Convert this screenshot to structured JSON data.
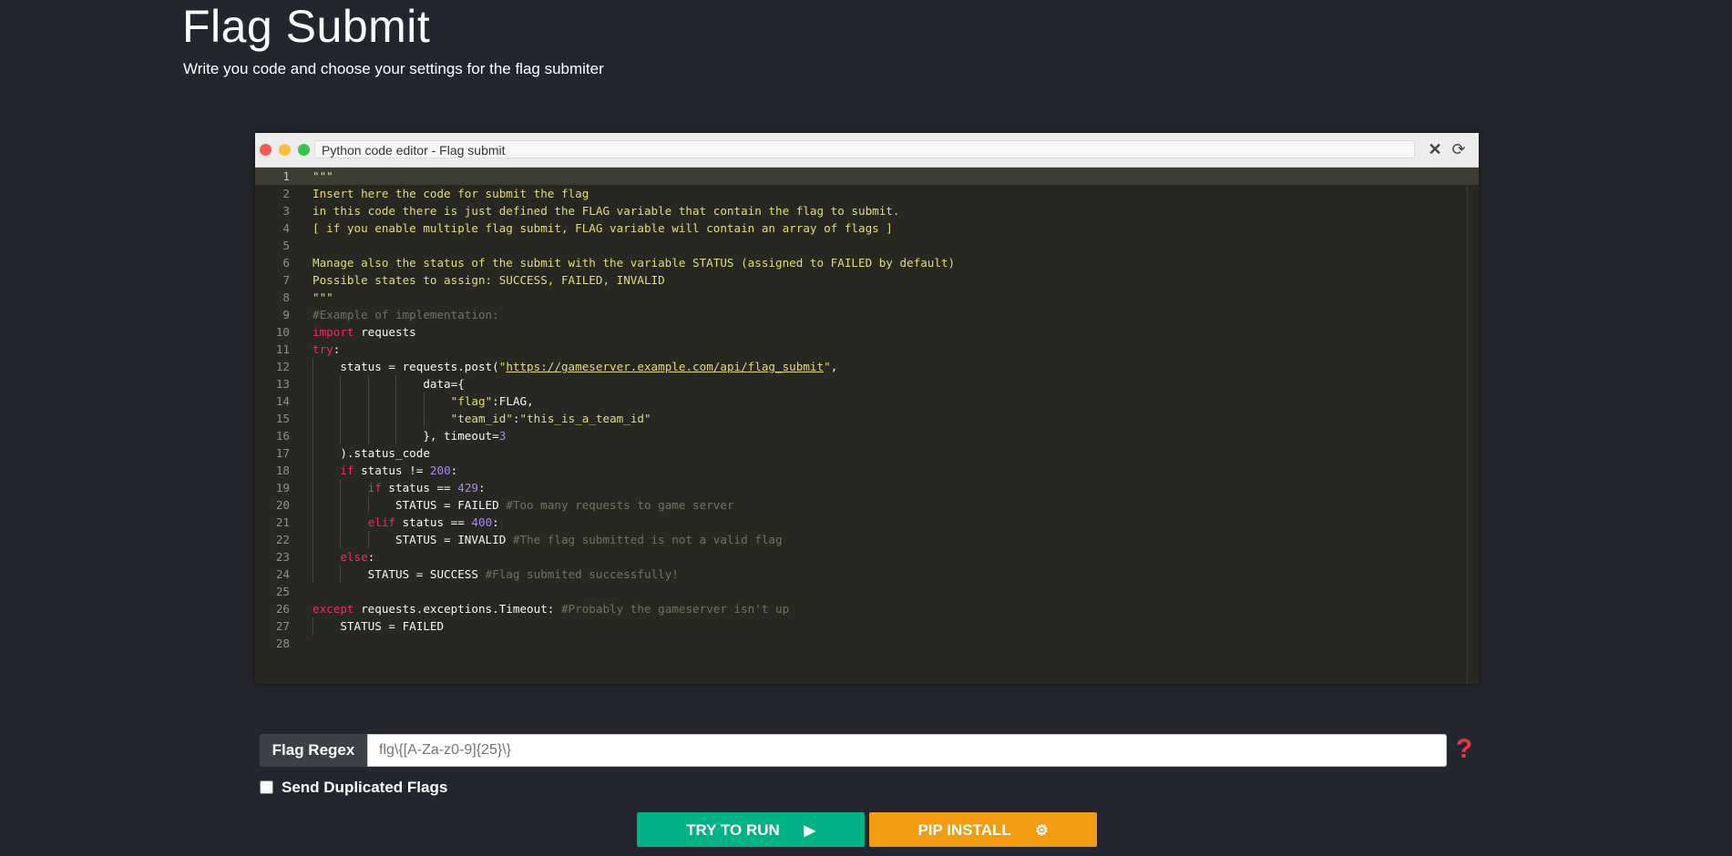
{
  "header": {
    "title": "Flag Submit",
    "subtitle": "Write you code and choose your settings for the flag submiter"
  },
  "editor": {
    "title": "Python code editor - Flag submit",
    "active_line": 1,
    "lines": [
      [
        {
          "t": "\"\"\"",
          "c": "str"
        }
      ],
      [
        {
          "t": "Insert here the code for submit the flag",
          "c": "str"
        }
      ],
      [
        {
          "t": "in this code there is just defined the FLAG variable that contain the flag to submit.",
          "c": "str"
        }
      ],
      [
        {
          "t": "[ if you enable multiple flag submit, FLAG variable will contain an array of flags ]",
          "c": "str"
        }
      ],
      [],
      [
        {
          "t": "Manage also the status of the submit with the variable STATUS (assigned to FAILED by default)",
          "c": "str"
        }
      ],
      [
        {
          "t": "Possible states to assign: SUCCESS, FAILED, INVALID",
          "c": "str"
        }
      ],
      [
        {
          "t": "\"\"\"",
          "c": "str"
        }
      ],
      [
        {
          "t": "#Example of implementation:",
          "c": "cm"
        }
      ],
      [
        {
          "t": "import",
          "c": "kw"
        },
        {
          "t": " requests",
          "c": ""
        }
      ],
      [
        {
          "t": "try",
          "c": "kw"
        },
        {
          "t": ":",
          "c": ""
        }
      ],
      [
        {
          "t": "    status = requests.post(",
          "c": ""
        },
        {
          "t": "\"",
          "c": "str"
        },
        {
          "t": "https://gameserver.example.com/api/flag_submit",
          "c": "url"
        },
        {
          "t": "\"",
          "c": "str"
        },
        {
          "t": ",",
          "c": ""
        }
      ],
      [
        {
          "t": "                data={",
          "c": ""
        }
      ],
      [
        {
          "t": "                    ",
          "c": ""
        },
        {
          "t": "\"flag\"",
          "c": "str"
        },
        {
          "t": ":FLAG,",
          "c": ""
        }
      ],
      [
        {
          "t": "                    ",
          "c": ""
        },
        {
          "t": "\"team_id\"",
          "c": "str"
        },
        {
          "t": ":",
          "c": ""
        },
        {
          "t": "\"this_is_a_team_id\"",
          "c": "str"
        }
      ],
      [
        {
          "t": "                }, timeout=",
          "c": ""
        },
        {
          "t": "3",
          "c": "num"
        }
      ],
      [
        {
          "t": "    ).status_code",
          "c": ""
        }
      ],
      [
        {
          "t": "    ",
          "c": ""
        },
        {
          "t": "if",
          "c": "kw"
        },
        {
          "t": " status != ",
          "c": ""
        },
        {
          "t": "200",
          "c": "num"
        },
        {
          "t": ":",
          "c": ""
        }
      ],
      [
        {
          "t": "        ",
          "c": ""
        },
        {
          "t": "if",
          "c": "kw"
        },
        {
          "t": " status == ",
          "c": ""
        },
        {
          "t": "429",
          "c": "num"
        },
        {
          "t": ":",
          "c": ""
        }
      ],
      [
        {
          "t": "            STATUS = FAILED ",
          "c": ""
        },
        {
          "t": "#Too many requests to game server",
          "c": "cm"
        }
      ],
      [
        {
          "t": "        ",
          "c": ""
        },
        {
          "t": "elif",
          "c": "kw"
        },
        {
          "t": " status == ",
          "c": ""
        },
        {
          "t": "400",
          "c": "num"
        },
        {
          "t": ":",
          "c": ""
        }
      ],
      [
        {
          "t": "            STATUS = INVALID ",
          "c": ""
        },
        {
          "t": "#The flag submitted is not a valid flag",
          "c": "cm"
        }
      ],
      [
        {
          "t": "    ",
          "c": ""
        },
        {
          "t": "else",
          "c": "kw"
        },
        {
          "t": ":",
          "c": ""
        }
      ],
      [
        {
          "t": "        STATUS = SUCCESS ",
          "c": ""
        },
        {
          "t": "#Flag submited successfully!",
          "c": "cm"
        }
      ],
      [],
      [
        {
          "t": "except",
          "c": "kw"
        },
        {
          "t": " requests.exceptions.Timeout: ",
          "c": ""
        },
        {
          "t": "#Probably the gameserver isn't up",
          "c": "cm"
        }
      ],
      [
        {
          "t": "    STATUS = FAILED",
          "c": ""
        }
      ],
      []
    ]
  },
  "settings": {
    "regex_label": "Flag Regex",
    "regex_placeholder": "flg\\{[A-Za-z0-9]{25}\\}",
    "duplicate_label": "Send Duplicated Flags",
    "duplicate_checked": false
  },
  "actions": {
    "run_label": "TRY TO RUN",
    "pip_label": "PIP INSTALL"
  },
  "colors": {
    "run": "#00b386",
    "pip": "#f39c12",
    "help": "#e53945"
  },
  "icons": {
    "run": "play-icon",
    "pip": "gear-icon",
    "help": "question-icon"
  }
}
